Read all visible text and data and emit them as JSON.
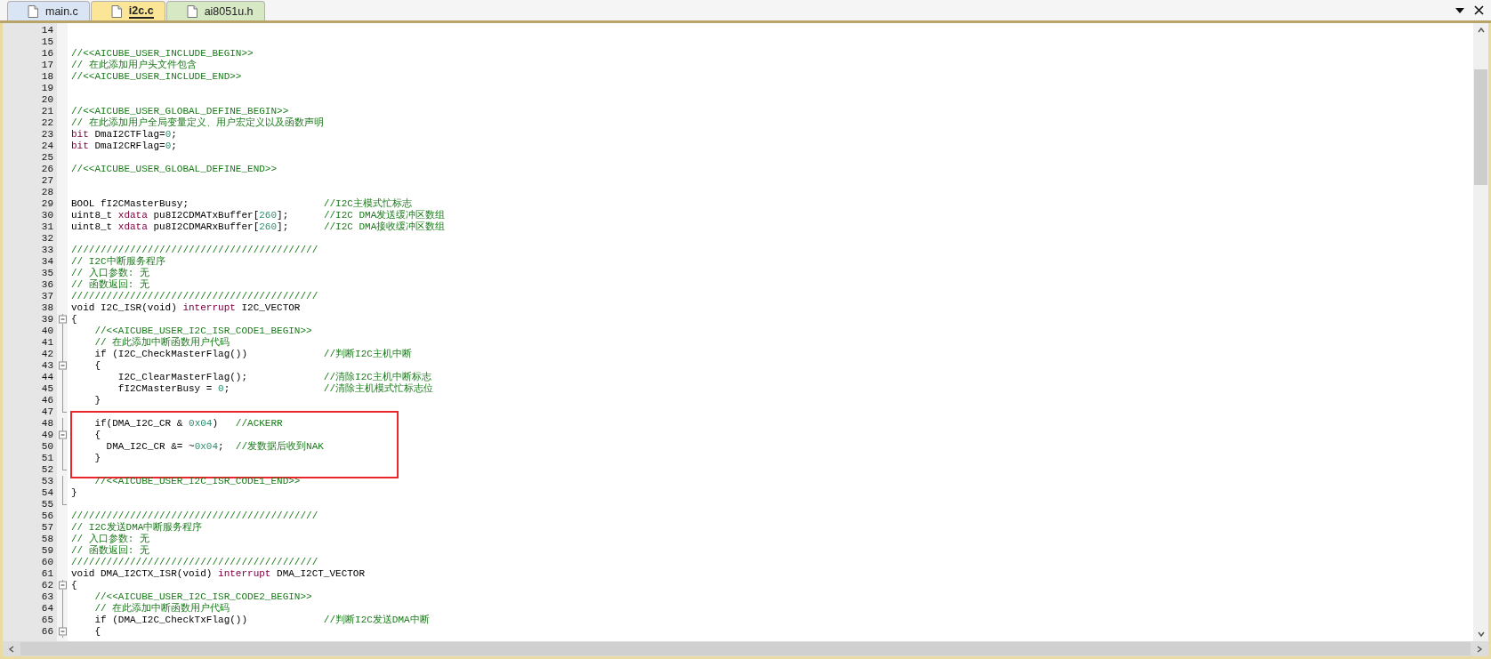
{
  "tabs": [
    {
      "label": "main.c",
      "selected": false,
      "color": "#d9e4f5"
    },
    {
      "label": "i2c.c",
      "selected": true,
      "color": "#fbe596"
    },
    {
      "label": "ai8051u.h",
      "selected": false,
      "color": "#d6e8c4"
    }
  ],
  "lines": [
    {
      "number": "14",
      "highlighted": false
    },
    {
      "number": "15",
      "highlighted": false
    },
    {
      "number": "16",
      "highlighted": false,
      "tokens": [
        {
          "kind": "comment",
          "text": "//<<AICUBE_USER_INCLUDE_BEGIN>>"
        }
      ]
    },
    {
      "number": "17",
      "highlighted": false,
      "tokens": [
        {
          "kind": "comment",
          "text": "// 在此添加用户头文件包含"
        }
      ]
    },
    {
      "number": "18",
      "highlighted": false,
      "tokens": [
        {
          "kind": "comment",
          "text": "//<<AICUBE_USER_INCLUDE_END>>"
        }
      ]
    },
    {
      "number": "19",
      "highlighted": false
    },
    {
      "number": "20",
      "highlighted": false
    },
    {
      "number": "21",
      "highlighted": false,
      "tokens": [
        {
          "kind": "comment",
          "text": "//<<AICUBE_USER_GLOBAL_DEFINE_BEGIN>>"
        }
      ]
    },
    {
      "number": "22",
      "highlighted": false,
      "tokens": [
        {
          "kind": "comment",
          "text": "// 在此添加用户全局变量定义、用户宏定义以及函数声明"
        }
      ]
    },
    {
      "number": "23",
      "highlighted": false,
      "tokens": [
        {
          "kind": "keyword",
          "text": "bit"
        },
        {
          "kind": "plain",
          "text": " DmaI2CTFlag="
        },
        {
          "kind": "number",
          "text": "0"
        },
        {
          "kind": "plain",
          "text": ";"
        }
      ]
    },
    {
      "number": "24",
      "highlighted": false,
      "tokens": [
        {
          "kind": "keyword",
          "text": "bit"
        },
        {
          "kind": "plain",
          "text": " DmaI2CRFlag="
        },
        {
          "kind": "number",
          "text": "0"
        },
        {
          "kind": "plain",
          "text": ";"
        }
      ]
    },
    {
      "number": "25",
      "highlighted": false
    },
    {
      "number": "26",
      "highlighted": false,
      "tokens": [
        {
          "kind": "comment",
          "text": "//<<AICUBE_USER_GLOBAL_DEFINE_END>>"
        }
      ]
    },
    {
      "number": "27",
      "highlighted": false
    },
    {
      "number": "28",
      "highlighted": false
    },
    {
      "number": "29",
      "highlighted": false,
      "tokens": [
        {
          "kind": "plain",
          "text": "BOOL fI2CMasterBusy;                       "
        },
        {
          "kind": "comment",
          "text": "//I2C主模式忙标志"
        }
      ]
    },
    {
      "number": "30",
      "highlighted": false,
      "tokens": [
        {
          "kind": "plain",
          "text": "uint8_t "
        },
        {
          "kind": "keyword",
          "text": "xdata"
        },
        {
          "kind": "plain",
          "text": " pu8I2CDMATxBuffer["
        },
        {
          "kind": "number",
          "text": "260"
        },
        {
          "kind": "plain",
          "text": "];      "
        },
        {
          "kind": "comment",
          "text": "//I2C DMA发送缓冲区数组"
        }
      ]
    },
    {
      "number": "31",
      "highlighted": false,
      "tokens": [
        {
          "kind": "plain",
          "text": "uint8_t "
        },
        {
          "kind": "keyword",
          "text": "xdata"
        },
        {
          "kind": "plain",
          "text": " pu8I2CDMARxBuffer["
        },
        {
          "kind": "number",
          "text": "260"
        },
        {
          "kind": "plain",
          "text": "];      "
        },
        {
          "kind": "comment",
          "text": "//I2C DMA接收缓冲区数组"
        }
      ]
    },
    {
      "number": "32",
      "highlighted": false
    },
    {
      "number": "33",
      "highlighted": false,
      "tokens": [
        {
          "kind": "comment",
          "text": "//////////////////////////////////////////"
        }
      ]
    },
    {
      "number": "34",
      "highlighted": false,
      "tokens": [
        {
          "kind": "comment",
          "text": "// I2C中断服务程序"
        }
      ]
    },
    {
      "number": "35",
      "highlighted": false,
      "tokens": [
        {
          "kind": "comment",
          "text": "// 入口参数: 无"
        }
      ]
    },
    {
      "number": "36",
      "highlighted": false,
      "tokens": [
        {
          "kind": "comment",
          "text": "// 函数返回: 无"
        }
      ]
    },
    {
      "number": "37",
      "highlighted": false,
      "tokens": [
        {
          "kind": "comment",
          "text": "//////////////////////////////////////////"
        }
      ]
    },
    {
      "number": "38",
      "highlighted": false,
      "tokens": [
        {
          "kind": "plain",
          "text": "void I2C_ISR(void) "
        },
        {
          "kind": "keyword",
          "text": "interrupt"
        },
        {
          "kind": "plain",
          "text": " I2C_VECTOR"
        }
      ]
    },
    {
      "number": "39",
      "highlighted": false,
      "kind": "fold_open",
      "tokens": [
        {
          "kind": "plain",
          "text": "{"
        }
      ]
    },
    {
      "number": "40",
      "highlighted": false,
      "kind": "fold_line",
      "tokens": [
        {
          "kind": "comment",
          "text": "    //<<AICUBE_USER_I2C_ISR_CODE1_BEGIN>>"
        }
      ]
    },
    {
      "number": "41",
      "highlighted": false,
      "kind": "fold_line",
      "tokens": [
        {
          "kind": "comment",
          "text": "    // 在此添加中断函数用户代码"
        }
      ]
    },
    {
      "number": "42",
      "highlighted": false,
      "kind": "fold_line",
      "tokens": [
        {
          "kind": "plain",
          "text": "    if (I2C_CheckMasterFlag())             "
        },
        {
          "kind": "comment",
          "text": "//判断I2C主机中断"
        }
      ]
    },
    {
      "number": "43",
      "highlighted": false,
      "kind": "fold_open",
      "tokens": [
        {
          "kind": "plain",
          "text": "    {"
        }
      ]
    },
    {
      "number": "44",
      "highlighted": false,
      "kind": "fold_line",
      "tokens": [
        {
          "kind": "plain",
          "text": "        I2C_ClearMasterFlag();             "
        },
        {
          "kind": "comment",
          "text": "//清除I2C主机中断标志"
        }
      ]
    },
    {
      "number": "45",
      "highlighted": false,
      "kind": "fold_line",
      "tokens": [
        {
          "kind": "plain",
          "text": "        fI2CMasterBusy = "
        },
        {
          "kind": "number",
          "text": "0"
        },
        {
          "kind": "plain",
          "text": ";                "
        },
        {
          "kind": "comment",
          "text": "//清除主机模式忙标志位"
        }
      ]
    },
    {
      "number": "46",
      "highlighted": false,
      "kind": "fold_line",
      "tokens": [
        {
          "kind": "plain",
          "text": "    }"
        }
      ]
    },
    {
      "number": "47",
      "highlighted": false,
      "kind": "fold_end"
    },
    {
      "number": "48",
      "highlighted": true,
      "kind": "fold_line",
      "tokens": [
        {
          "kind": "plain",
          "text": "    if(DMA_I2C_CR & "
        },
        {
          "kind": "number",
          "text": "0x04"
        },
        {
          "kind": "plain",
          "text": ")   "
        },
        {
          "kind": "comment",
          "text": "//ACKERR"
        }
      ]
    },
    {
      "number": "49",
      "highlighted": true,
      "kind": "fold_open",
      "tokens": [
        {
          "kind": "plain",
          "text": "    {"
        }
      ]
    },
    {
      "number": "50",
      "highlighted": true,
      "kind": "fold_line",
      "tokens": [
        {
          "kind": "plain",
          "text": "      DMA_I2C_CR &= ~"
        },
        {
          "kind": "number",
          "text": "0x04"
        },
        {
          "kind": "plain",
          "text": ";  "
        },
        {
          "kind": "comment",
          "text": "//发数据后收到NAK"
        }
      ]
    },
    {
      "number": "51",
      "highlighted": true,
      "kind": "fold_line",
      "tokens": [
        {
          "kind": "plain",
          "text": "    }"
        }
      ]
    },
    {
      "number": "52",
      "highlighted": true,
      "kind": "fold_end"
    },
    {
      "number": "53",
      "highlighted": false,
      "kind": "fold_line",
      "tokens": [
        {
          "kind": "comment",
          "text": "    //<<AICUBE_USER_I2C_ISR_CODE1_END>>"
        }
      ]
    },
    {
      "number": "54",
      "highlighted": false,
      "kind": "fold_line",
      "tokens": [
        {
          "kind": "plain",
          "text": "}"
        }
      ]
    },
    {
      "number": "55",
      "highlighted": false,
      "kind": "fold_end"
    },
    {
      "number": "56",
      "highlighted": false,
      "tokens": [
        {
          "kind": "comment",
          "text": "//////////////////////////////////////////"
        }
      ]
    },
    {
      "number": "57",
      "highlighted": false,
      "tokens": [
        {
          "kind": "comment",
          "text": "// I2C发送DMA中断服务程序"
        }
      ]
    },
    {
      "number": "58",
      "highlighted": false,
      "tokens": [
        {
          "kind": "comment",
          "text": "// 入口参数: 无"
        }
      ]
    },
    {
      "number": "59",
      "highlighted": false,
      "tokens": [
        {
          "kind": "comment",
          "text": "// 函数返回: 无"
        }
      ]
    },
    {
      "number": "60",
      "highlighted": false,
      "tokens": [
        {
          "kind": "comment",
          "text": "//////////////////////////////////////////"
        }
      ]
    },
    {
      "number": "61",
      "highlighted": false,
      "tokens": [
        {
          "kind": "plain",
          "text": "void DMA_I2CTX_ISR(void) "
        },
        {
          "kind": "keyword",
          "text": "interrupt"
        },
        {
          "kind": "plain",
          "text": " DMA_I2CT_VECTOR"
        }
      ]
    },
    {
      "number": "62",
      "highlighted": false,
      "kind": "fold_open",
      "tokens": [
        {
          "kind": "plain",
          "text": "{"
        }
      ]
    },
    {
      "number": "63",
      "highlighted": false,
      "kind": "fold_line",
      "tokens": [
        {
          "kind": "comment",
          "text": "    //<<AICUBE_USER_I2C_ISR_CODE2_BEGIN>>"
        }
      ]
    },
    {
      "number": "64",
      "highlighted": false,
      "kind": "fold_line",
      "tokens": [
        {
          "kind": "comment",
          "text": "    // 在此添加中断函数用户代码"
        }
      ]
    },
    {
      "number": "65",
      "highlighted": false,
      "kind": "fold_line",
      "tokens": [
        {
          "kind": "plain",
          "text": "    if (DMA_I2C_CheckTxFlag())             "
        },
        {
          "kind": "comment",
          "text": "//判断I2C发送DMA中断"
        }
      ]
    },
    {
      "number": "66",
      "highlighted": false,
      "kind": "fold_open",
      "tokens": [
        {
          "kind": "plain",
          "text": "    {"
        }
      ]
    }
  ]
}
